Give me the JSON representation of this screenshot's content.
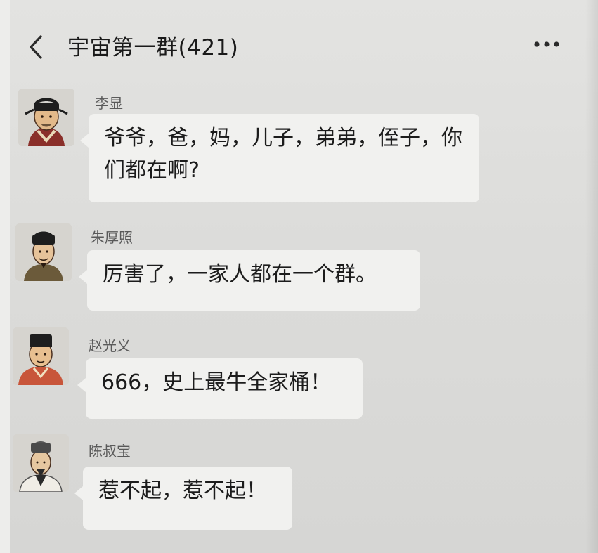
{
  "header": {
    "back_icon": "chevron-left-icon",
    "title": "宇宙第一群(421)",
    "more_icon": "more-dots-icon"
  },
  "messages": [
    {
      "sender": "李显",
      "text": "爷爷，爸，妈，儿子，弟弟，侄子，你们都在啊?"
    },
    {
      "sender": "朱厚照",
      "text": "厉害了，一家人都在一个群。"
    },
    {
      "sender": "赵光义",
      "text": "666，史上最牛全家桶！"
    },
    {
      "sender": "陈叔宝",
      "text": "惹不起，惹不起！"
    }
  ]
}
